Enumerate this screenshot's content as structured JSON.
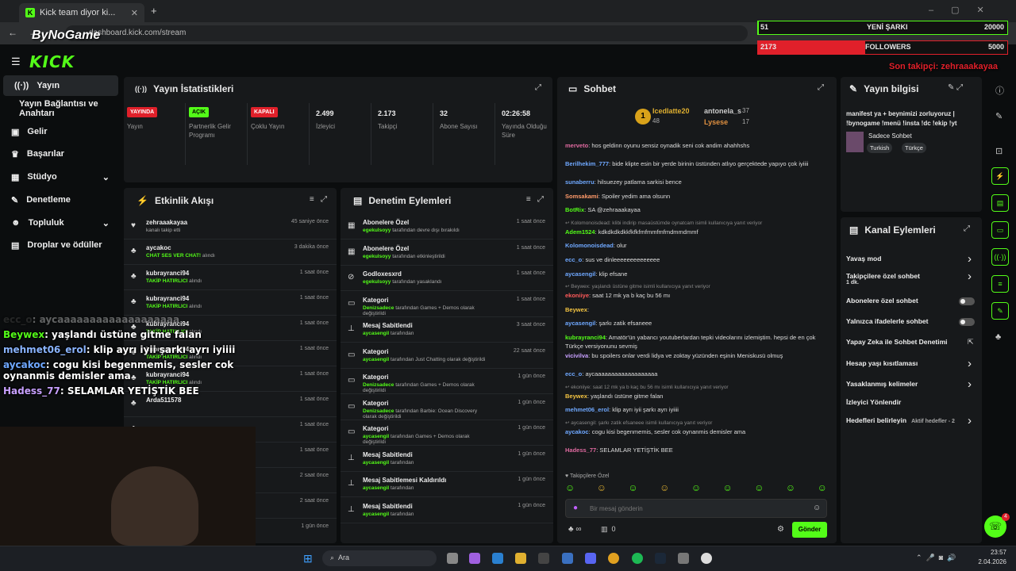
{
  "browser": {
    "tab_title": "Kick team diyor ki...",
    "url": "dashboard.kick.com/stream",
    "watermark": "ByNoGame"
  },
  "brand": {
    "logo": "KICK",
    "accent": "#53fc18"
  },
  "goals": {
    "songs_current": "51",
    "songs_label": "YENİ ŞARKI",
    "songs_target": "20000",
    "followers_current": "2173",
    "followers_label": "FOLLOWERS",
    "followers_target": "5000",
    "last_follower": "Son takipçi: zehraaakayaa"
  },
  "sidebar": {
    "items": [
      "Yayın",
      "Yayın Bağlantısı ve Anahtarı",
      "Gelir",
      "Başarılar",
      "Stüdyo",
      "Denetleme",
      "Topluluk",
      "Droplar ve ödüller"
    ]
  },
  "stats": {
    "title": "Yayın İstatistikleri",
    "cells": [
      {
        "badge": "YAYINDA",
        "label": "Yayın"
      },
      {
        "badge": "AÇIK",
        "label": "Partnerlik Gelir Programı"
      },
      {
        "badge": "KAPALI",
        "label": "Çoklu Yayın"
      },
      {
        "value": "2.499",
        "label": "İzleyici"
      },
      {
        "value": "2.173",
        "label": "Takipçi"
      },
      {
        "value": "32",
        "label": "Abone Sayısı"
      },
      {
        "value": "02:26:58",
        "label": "Yayında Olduğu Süre"
      }
    ]
  },
  "activity": {
    "title": "Etkinlik Akışı",
    "rows": [
      {
        "name": "zehraaakayaa",
        "sub": "kanalı takip etti",
        "time": "45 saniye önce"
      },
      {
        "name": "aycakoc",
        "sub_green": "CHAT SES VER CHAT!",
        "sub": " alındı",
        "time": "3 dakika önce"
      },
      {
        "name": "kubrayranci94",
        "sub_green": "TAKİP HATIRLICI",
        "sub": " alındı",
        "time": "1 saat önce"
      },
      {
        "name": "kubrayranci94",
        "sub_green": "TAKİP HATIRLICI",
        "sub": " alındı",
        "time": "1 saat önce"
      },
      {
        "name": "kubrayranci94",
        "sub_green": "TAKİP HATIRLICI",
        "sub": " alındı",
        "time": "1 saat önce"
      },
      {
        "name": "kubrayranci94",
        "sub_green": "TAKİP HATIRLICI",
        "sub": " alındı",
        "time": "1 saat önce"
      },
      {
        "name": "kubrayranci94",
        "sub_green": "TAKİP HATIRLICI",
        "sub": " alındı",
        "time": "1 saat önce"
      },
      {
        "name": "Arda511578",
        "sub": "",
        "time": "1 saat önce"
      },
      {
        "name": "",
        "sub": "",
        "time": "1 saat önce"
      },
      {
        "name": "",
        "sub": "",
        "time": "1 saat önce"
      },
      {
        "name": "",
        "sub": "",
        "time": "2 saat önce"
      },
      {
        "name": "",
        "sub": "",
        "time": "2 saat önce"
      },
      {
        "name": "",
        "sub": "",
        "time": "1 gün önce"
      }
    ]
  },
  "moderation": {
    "title": "Denetim Eylemleri",
    "rows": [
      {
        "title": "Abonelere Özel",
        "user": "egekulsoyy",
        "rest": " tarafından devre dışı bırakıldı",
        "time": "1 saat önce"
      },
      {
        "title": "Abonelere Özel",
        "user": "egekulsoyy",
        "rest": " tarafından etkinleştirildi",
        "time": "1 saat önce"
      },
      {
        "title": "Godloxesxrd",
        "user": "egekulsoyy",
        "rest": " tarafından yasaklandı",
        "time": "1 saat önce"
      },
      {
        "title": "Kategori",
        "user": "Denizsadece",
        "rest": " tarafından Games + Demos olarak değiştirildi",
        "time": "1 saat önce"
      },
      {
        "title": "Mesaj Sabitlendi",
        "user": "aycasengil",
        "rest": " tarafından",
        "time": "3 saat önce"
      },
      {
        "title": "Kategori",
        "user": "aycasengil",
        "rest": " tarafından Just Chatting olarak değiştirildi",
        "time": "22 saat önce"
      },
      {
        "title": "Kategori",
        "user": "Denizsadece",
        "rest": " tarafından Games + Demos olarak değiştirildi",
        "time": "1 gün önce"
      },
      {
        "title": "Kategori",
        "user": "Denizsadece",
        "rest": " tarafından Barbie: Ocean Discovery olarak değiştirildi",
        "time": "1 gün önce"
      },
      {
        "title": "Kategori",
        "user": "aycasengil",
        "rest": " tarafından Games + Demos olarak değiştirildi",
        "time": "1 gün önce"
      },
      {
        "title": "Mesaj Sabitlendi",
        "user": "aycasengil",
        "rest": " tarafından",
        "time": "1 gün önce"
      },
      {
        "title": "Mesaj Sabitlemesi Kaldırıldı",
        "user": "aycasengil",
        "rest": " tarafından",
        "time": "1 gün önce"
      },
      {
        "title": "Mesaj Sabitlendi",
        "user": "aycasengil",
        "rest": " tarafından",
        "time": "1 gün önce"
      }
    ]
  },
  "chat": {
    "title": "Sohbet",
    "top": [
      {
        "name": "Icedlatte20",
        "n": "48"
      },
      {
        "name": "antonela_s",
        "n": "37"
      },
      {
        "name": "Lysese",
        "n": "17"
      }
    ],
    "messages": [
      {
        "u": "merveto",
        "c": "#e06aa0",
        "t": ": hos geldinn oyunu sensiz oynadik seni cok andim ahahhshs"
      },
      {
        "u": "Berilhekim_777",
        "c": "#6fa8ff",
        "t": ": bide klipte esin bir yerde birinin üstünden atlıyo gerçektede yapıyo çok iyiiii"
      },
      {
        "u": "sunaberru",
        "c": "#6fa8ff",
        "t": ": hilsuezey patlama sarkisi bence"
      },
      {
        "u": "Somsakami",
        "c": "#ff9a6a",
        "t": ": Spoiler yedim ama olsunn"
      },
      {
        "u": "BotRix",
        "c": "#53fc18",
        "t": ": SA @zehraaakayaa"
      },
      {
        "reply": "Kolomonoisdead: klibi indirip masaüstümde oynatcam isimli kullanıcıya yanıt veriyor"
      },
      {
        "u": "Adem1524",
        "c": "#53fc18",
        "t": ": kdkdkdkdkkfkfkfmfmmfmfmdmmdmmf"
      },
      {
        "u": "Kolomonoisdead",
        "c": "#6fa8ff",
        "t": ": olur"
      },
      {
        "u": "ecc_o",
        "c": "#6fa8ff",
        "t": ": sus ve dinleeeeeeeeeeeeee"
      },
      {
        "u": "aycasengil",
        "c": "#6fa8ff",
        "t": ": klip efsane"
      },
      {
        "reply": "Beywex: yaşlandı üstüne gitme isimli kullanıcıya yanıt veriyor"
      },
      {
        "u": "ekoniiye",
        "c": "#ff5a5a",
        "t": ": saat 12 mk ya b kaç bu 56 mı"
      },
      {
        "u": "Beywex",
        "c": "#f5c542",
        "t": ":"
      },
      {
        "u": "aycasengil",
        "c": "#6fa8ff",
        "t": ": şarkı zatik efsaneee"
      },
      {
        "u": "kubrayranci94",
        "c": "#53fc18",
        "t": ": Amatör'ün yabancı youtuberlardan tepki videolarını izlemiştim. hepsi de en çok Türkçe versiyonunu sevmiş"
      },
      {
        "u": "vicivilva",
        "c": "#c8a0ff",
        "t": ": bu spoilers onlar verdi lidya ve zoktay yüzünden eşinin Meniskusü olmuş"
      },
      {
        "u": "ecc_o",
        "c": "#6fa8ff",
        "t": ": aycaaaaaaaaaaaaaaaaaaa"
      },
      {
        "reply": "ekoniiye: saat 12 mk ya b kaç bu 56 mı isimli kullanıcıya yanıt veriyor"
      },
      {
        "u": "Beywex",
        "c": "#f5c542",
        "t": ": yaşlandı üstüne gitme falan"
      },
      {
        "u": "mehmet06_erol",
        "c": "#6fa8ff",
        "t": ": klip ayrı iyii şarkı ayrı iyiiii"
      },
      {
        "reply": "aycasengil: şarkı zatik efsaneee isimli kullanıcıya yanıt veriyor"
      },
      {
        "u": "aycakoc",
        "c": "#6fa8ff",
        "t": ": cogu kisi begenmemis, sesler cok oynanmis demisler ama"
      },
      {
        "u": "Hadess_77",
        "c": "#e06aa0",
        "t": ": SELAMLAR YETİŞTİK BEE"
      }
    ],
    "followers_only": "Takipçilere Özel",
    "placeholder": "Bir mesaj gönderin",
    "send": "Gönder",
    "viewers_count": "0"
  },
  "info": {
    "title": "Yayın bilgisi",
    "stream_title": "manifest ya + beynimizi zorluyoruz | !bynogame !menü !insta !dc !ekip !yt",
    "category": "Sadece Sohbet",
    "tags": [
      "Turkish",
      "Türkçe"
    ]
  },
  "channel": {
    "title": "Kanal Eylemleri",
    "items": [
      {
        "label": "Yavaş mod",
        "kind": "chevron"
      },
      {
        "label": "Takipçilere özel sohbet",
        "sub": "1 dk.",
        "kind": "chevron"
      },
      {
        "label": "Abonelere özel sohbet",
        "kind": "toggle"
      },
      {
        "label": "Yalnızca ifadelerle sohbet",
        "kind": "toggle"
      },
      {
        "label": "Yapay Zeka ile Sohbet Denetimi",
        "kind": "ext"
      },
      {
        "label": "Hesap yaşı kısıtlaması",
        "kind": "chevron"
      },
      {
        "label": "Yasaklanmış kelimeler",
        "kind": "chevron"
      },
      {
        "label": "İzleyici Yönlendir",
        "kind": "none"
      },
      {
        "label": "Hedefleri belirleyin",
        "sub": "Aktif hedefler - 2",
        "kind": "chevron"
      }
    ]
  },
  "overlay_chat": [
    {
      "u": "ecc_o",
      "t": ": aycaaaaaaaaaaaaaaaaaaa"
    },
    {
      "u": "Beywex",
      "t": ": yaşlandı üstüne gitme falan"
    },
    {
      "u": "mehmet06_erol",
      "t": ": klip ayrı iyii şarkı ayrı iyiiii"
    },
    {
      "u": "aycakoc",
      "t": ": cogu kisi begenmemis, sesler cok oynanmis demisler ama"
    },
    {
      "u": "Hadess_77",
      "t": ": SELAMLAR YETİŞTİK BEE"
    }
  ],
  "taskbar": {
    "search": "Ara",
    "time": "23:57",
    "date": "2.04.2026"
  },
  "help_badge": "4"
}
